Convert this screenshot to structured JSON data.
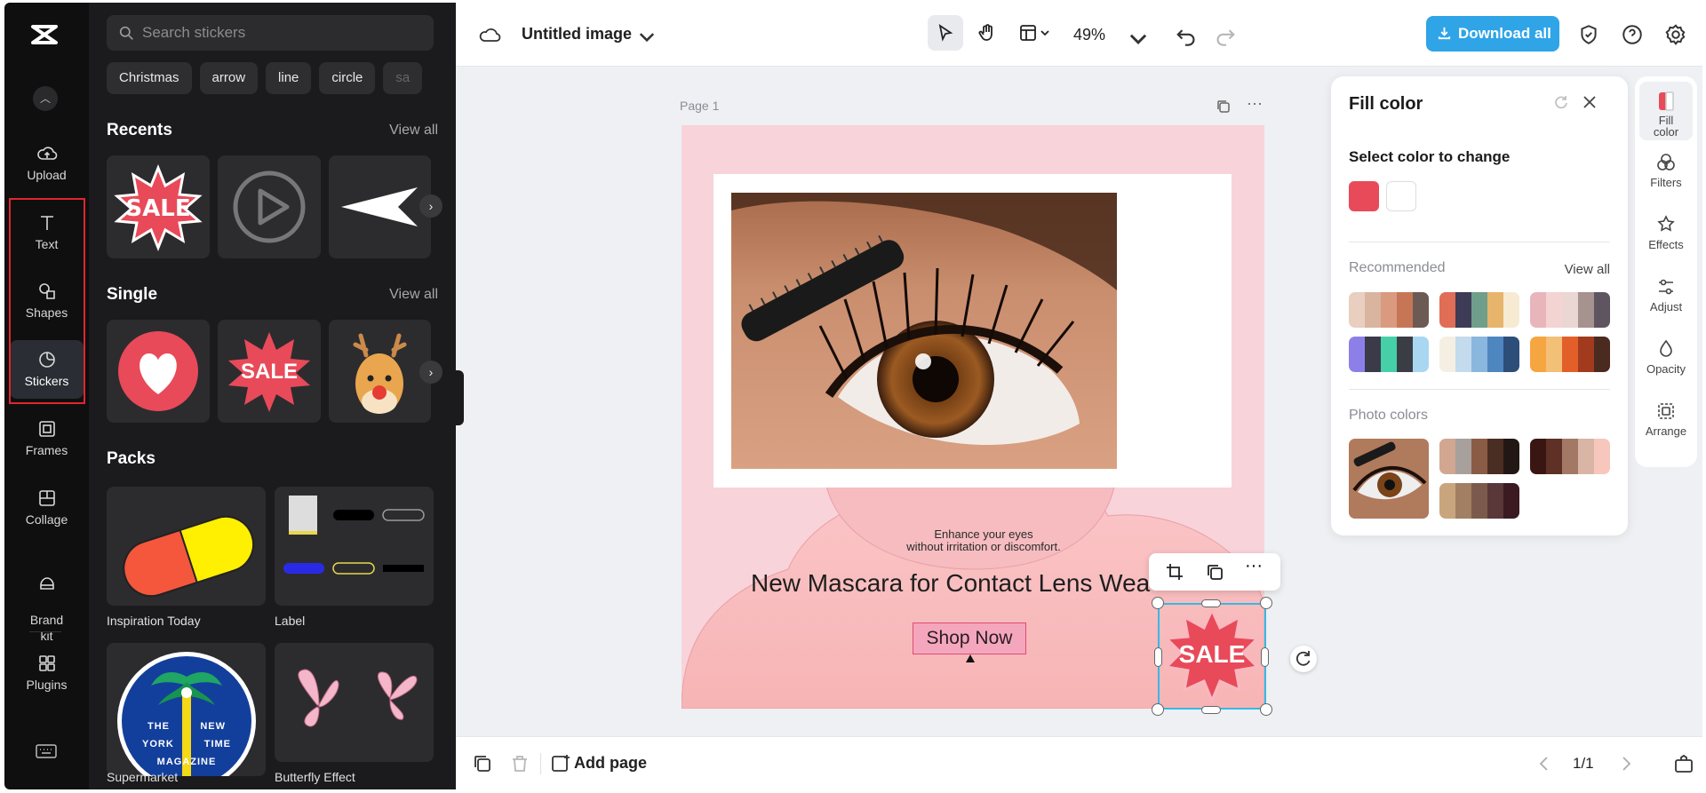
{
  "app": {
    "logo": "capcut-logo-icon"
  },
  "rail": {
    "items": [
      {
        "label": "Upload",
        "icon": "upload-cloud-icon"
      },
      {
        "label": "Text",
        "icon": "text-icon"
      },
      {
        "label": "Shapes",
        "icon": "shapes-icon"
      },
      {
        "label": "Stickers",
        "icon": "sticker-icon"
      },
      {
        "label": "Frames",
        "icon": "frame-icon"
      },
      {
        "label": "Collage",
        "icon": "collage-icon"
      },
      {
        "label": "Brand\nkit",
        "icon": "brand-kit-icon"
      },
      {
        "label": "Plugins",
        "icon": "plugins-icon"
      }
    ],
    "active": "Stickers"
  },
  "stickers": {
    "search_placeholder": "Search stickers",
    "chips": [
      "Christmas",
      "arrow",
      "line",
      "circle",
      "sa"
    ],
    "recents_title": "Recents",
    "single_title": "Single",
    "packs_title": "Packs",
    "view_all": "View all",
    "recent_sale_text": "SALE",
    "single_sale_text": "SALE",
    "packs": [
      {
        "label": "Inspiration Today"
      },
      {
        "label": "Label"
      },
      {
        "label": "Supermarket"
      },
      {
        "label": "Butterfly Effect"
      }
    ],
    "magazine_logo_lines": [
      "THE",
      "NEW",
      "YORK",
      "TIME",
      "MAGAZINE"
    ]
  },
  "topbar": {
    "title": "Untitled image",
    "zoom": "49%",
    "download_label": "Download all"
  },
  "canvas": {
    "page_label": "Page 1",
    "enhance_line1": "Enhance your eyes",
    "enhance_line2": "without irritation or discomfort.",
    "headline": "New Mascara for Contact Lens Wea",
    "cta": "Shop Now",
    "sale_sticker": "SALE"
  },
  "fill_panel": {
    "title": "Fill color",
    "select_label": "Select color to change",
    "selected_colors": [
      "#e84a59",
      "#ffffff"
    ],
    "recommended_label": "Recommended",
    "view_all": "View all",
    "recommended_palettes": [
      [
        "#e9cfc0",
        "#d9b49f",
        "#d99a80",
        "#c77655",
        "#6c5a55"
      ],
      [
        "#e06d55",
        "#3d3b55",
        "#6f9e8b",
        "#e7b46c",
        "#f6ead2"
      ],
      [
        "#e8b5bb",
        "#f4d3d3",
        "#ead6d3",
        "#a6928e",
        "#5e5560"
      ],
      [
        "#8c80e8",
        "#3a3a49",
        "#45d0a8",
        "#3b3d44",
        "#a9d7f2"
      ],
      [
        "#f5efe3",
        "#c3dbec",
        "#8ab7de",
        "#4e86c0",
        "#2d4e79"
      ],
      [
        "#f6a640",
        "#f3c078",
        "#e35f2a",
        "#a23b1e",
        "#4b2a20"
      ]
    ],
    "photo_colors_label": "Photo colors",
    "photo_palettes": [
      [
        "#d2a792",
        "#a7a09d",
        "#8b5c45",
        "#4a2d23",
        "#221715"
      ],
      [
        "#3a1612",
        "#5f3025",
        "#a37966",
        "#d8b5a5",
        "#f7c6bd"
      ],
      [
        "#c9a57e",
        "#a27f63",
        "#7c5a4b",
        "#5a3738",
        "#3b1a22"
      ]
    ]
  },
  "right_tools": [
    {
      "label": "Fill\ncolor",
      "icon": "fill-color-icon"
    },
    {
      "label": "Filters",
      "icon": "filters-icon"
    },
    {
      "label": "Effects",
      "icon": "effects-icon"
    },
    {
      "label": "Adjust",
      "icon": "adjust-icon"
    },
    {
      "label": "Opacity",
      "icon": "opacity-icon"
    },
    {
      "label": "Arrange",
      "icon": "arrange-icon"
    }
  ],
  "bottombar": {
    "add_page": "Add page",
    "page_indicator": "1/1"
  },
  "colors": {
    "accent": "#2fa4e7",
    "selection": "#35b9e6",
    "highlight_box": "#e0262d",
    "sale_red": "#e84a59"
  }
}
